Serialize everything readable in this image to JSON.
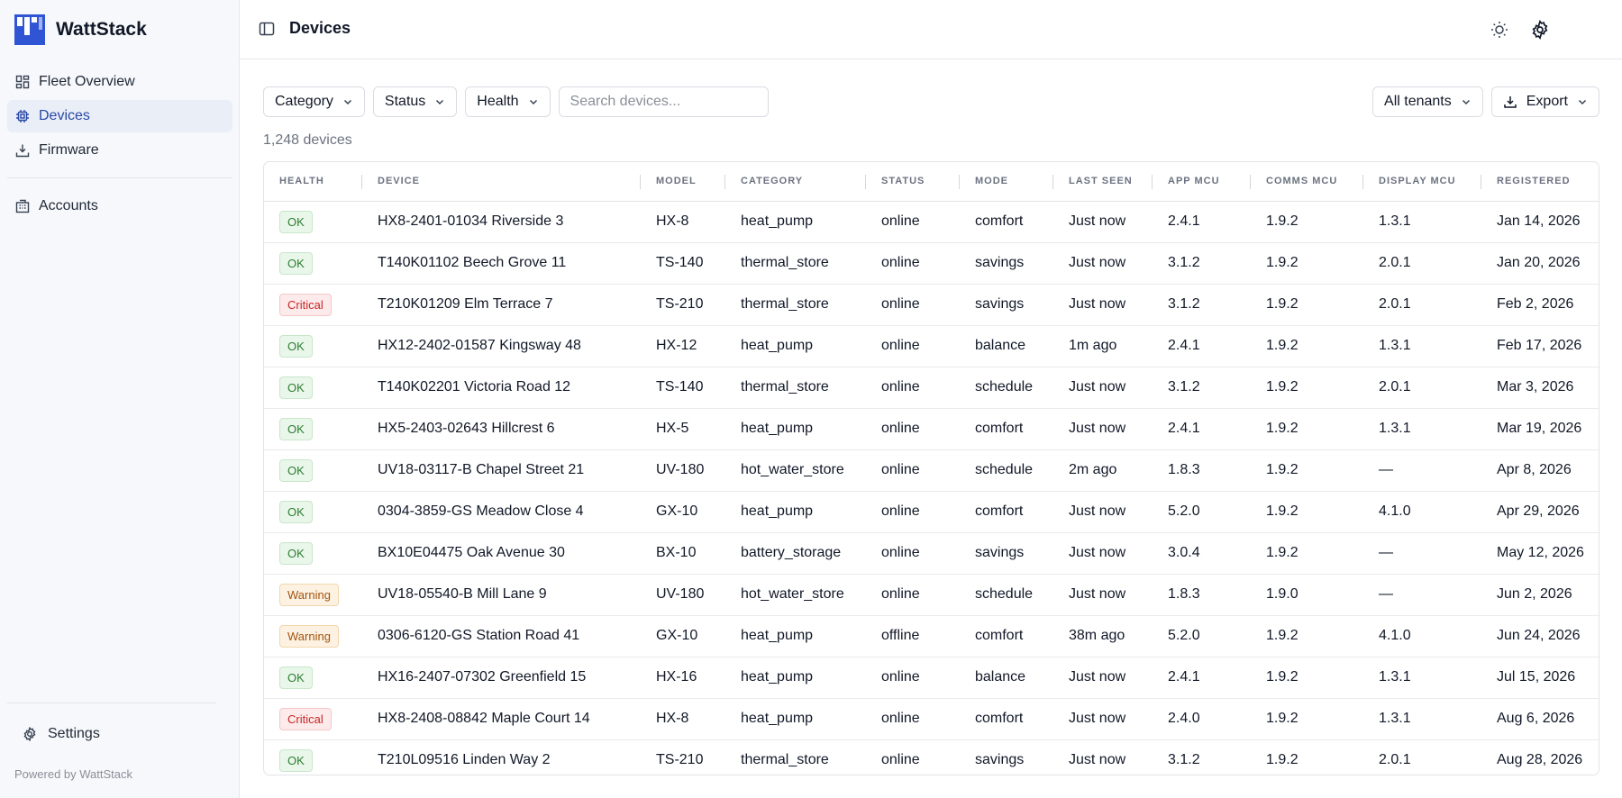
{
  "brand": {
    "name": "WattStack",
    "accent": "#2f55d4"
  },
  "sidebar": {
    "items": [
      {
        "label": "Fleet Overview",
        "icon": "dashboard-icon"
      },
      {
        "label": "Devices",
        "icon": "chip-icon",
        "active": true
      },
      {
        "label": "Firmware",
        "icon": "download-tray-icon"
      },
      {
        "label": "Accounts",
        "icon": "building-icon"
      }
    ],
    "settings_label": "Settings",
    "powered_by": "Powered by WattStack"
  },
  "header": {
    "title": "Devices"
  },
  "toolbar": {
    "category_label": "Category",
    "status_label": "Status",
    "health_label": "Health",
    "search_placeholder": "Search devices...",
    "tenants_label": "All tenants",
    "export_label": "Export"
  },
  "device_count": "1,248 devices",
  "table": {
    "columns": [
      "Health",
      "Device",
      "Model",
      "Category",
      "Status",
      "Mode",
      "Last Seen",
      "App MCU",
      "Comms MCU",
      "Display MCU",
      "Registered"
    ],
    "rows": [
      {
        "health": "OK",
        "device": "HX8-2401-01034 Riverside 3",
        "model": "HX-8",
        "category": "heat_pump",
        "status": "online",
        "mode": "comfort",
        "last_seen": "Just now",
        "app_mcu": "2.4.1",
        "comms_mcu": "1.9.2",
        "display_mcu": "1.3.1",
        "registered": "Jan 14, 2026"
      },
      {
        "health": "OK",
        "device": "T140K01102 Beech Grove 11",
        "model": "TS-140",
        "category": "thermal_store",
        "status": "online",
        "mode": "savings",
        "last_seen": "Just now",
        "app_mcu": "3.1.2",
        "comms_mcu": "1.9.2",
        "display_mcu": "2.0.1",
        "registered": "Jan 20, 2026"
      },
      {
        "health": "Critical",
        "device": "T210K01209 Elm Terrace 7",
        "model": "TS-210",
        "category": "thermal_store",
        "status": "online",
        "mode": "savings",
        "last_seen": "Just now",
        "app_mcu": "3.1.2",
        "comms_mcu": "1.9.2",
        "display_mcu": "2.0.1",
        "registered": "Feb 2, 2026"
      },
      {
        "health": "OK",
        "device": "HX12-2402-01587 Kingsway 48",
        "model": "HX-12",
        "category": "heat_pump",
        "status": "online",
        "mode": "balance",
        "last_seen": "1m ago",
        "app_mcu": "2.4.1",
        "comms_mcu": "1.9.2",
        "display_mcu": "1.3.1",
        "registered": "Feb 17, 2026"
      },
      {
        "health": "OK",
        "device": "T140K02201 Victoria Road 12",
        "model": "TS-140",
        "category": "thermal_store",
        "status": "online",
        "mode": "schedule",
        "last_seen": "Just now",
        "app_mcu": "3.1.2",
        "comms_mcu": "1.9.2",
        "display_mcu": "2.0.1",
        "registered": "Mar 3, 2026"
      },
      {
        "health": "OK",
        "device": "HX5-2403-02643 Hillcrest 6",
        "model": "HX-5",
        "category": "heat_pump",
        "status": "online",
        "mode": "comfort",
        "last_seen": "Just now",
        "app_mcu": "2.4.1",
        "comms_mcu": "1.9.2",
        "display_mcu": "1.3.1",
        "registered": "Mar 19, 2026"
      },
      {
        "health": "OK",
        "device": "UV18-03117-B Chapel Street 21",
        "model": "UV-180",
        "category": "hot_water_store",
        "status": "online",
        "mode": "schedule",
        "last_seen": "2m ago",
        "app_mcu": "1.8.3",
        "comms_mcu": "1.9.2",
        "display_mcu": "—",
        "registered": "Apr 8, 2026"
      },
      {
        "health": "OK",
        "device": "0304-3859-GS Meadow Close 4",
        "model": "GX-10",
        "category": "heat_pump",
        "status": "online",
        "mode": "comfort",
        "last_seen": "Just now",
        "app_mcu": "5.2.0",
        "comms_mcu": "1.9.2",
        "display_mcu": "4.1.0",
        "registered": "Apr 29, 2026"
      },
      {
        "health": "OK",
        "device": "BX10E04475 Oak Avenue 30",
        "model": "BX-10",
        "category": "battery_storage",
        "status": "online",
        "mode": "savings",
        "last_seen": "Just now",
        "app_mcu": "3.0.4",
        "comms_mcu": "1.9.2",
        "display_mcu": "—",
        "registered": "May 12, 2026"
      },
      {
        "health": "Warning",
        "device": "UV18-05540-B Mill Lane 9",
        "model": "UV-180",
        "category": "hot_water_store",
        "status": "online",
        "mode": "schedule",
        "last_seen": "Just now",
        "app_mcu": "1.8.3",
        "comms_mcu": "1.9.0",
        "display_mcu": "—",
        "registered": "Jun 2, 2026"
      },
      {
        "health": "Warning",
        "device": "0306-6120-GS Station Road 41",
        "model": "GX-10",
        "category": "heat_pump",
        "status": "offline",
        "mode": "comfort",
        "last_seen": "38m ago",
        "app_mcu": "5.2.0",
        "comms_mcu": "1.9.2",
        "display_mcu": "4.1.0",
        "registered": "Jun 24, 2026"
      },
      {
        "health": "OK",
        "device": "HX16-2407-07302 Greenfield 15",
        "model": "HX-16",
        "category": "heat_pump",
        "status": "online",
        "mode": "balance",
        "last_seen": "Just now",
        "app_mcu": "2.4.1",
        "comms_mcu": "1.9.2",
        "display_mcu": "1.3.1",
        "registered": "Jul 15, 2026"
      },
      {
        "health": "Critical",
        "device": "HX8-2408-08842 Maple Court 14",
        "model": "HX-8",
        "category": "heat_pump",
        "status": "online",
        "mode": "comfort",
        "last_seen": "Just now",
        "app_mcu": "2.4.0",
        "comms_mcu": "1.9.2",
        "display_mcu": "1.3.1",
        "registered": "Aug 6, 2026"
      },
      {
        "health": "OK",
        "device": "T210L09516 Linden Way 2",
        "model": "TS-210",
        "category": "thermal_store",
        "status": "online",
        "mode": "savings",
        "last_seen": "Just now",
        "app_mcu": "3.1.2",
        "comms_mcu": "1.9.2",
        "display_mcu": "2.0.1",
        "registered": "Aug 28, 2026"
      }
    ]
  },
  "header_icons": [
    "sun-icon",
    "gear-icon"
  ],
  "colors": {
    "ok": "#2f7d32",
    "critical": "#c62828",
    "warning": "#a25410",
    "active_nav": "#2747a6"
  }
}
